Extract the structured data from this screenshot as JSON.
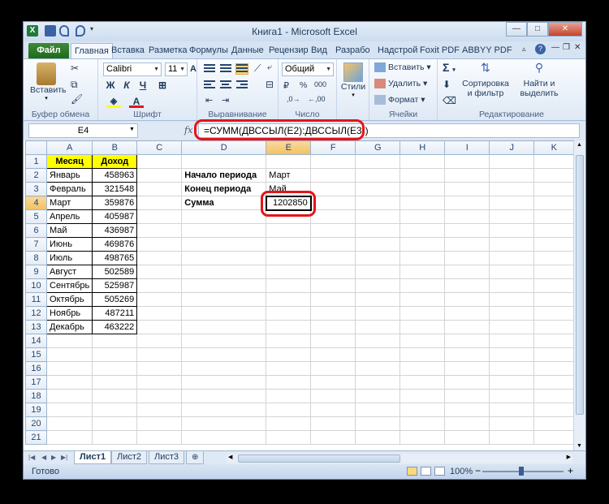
{
  "window": {
    "title": "Книга1  -  Microsoft Excel",
    "minimize": "—",
    "maximize": "□",
    "close": "✕"
  },
  "tabs": [
    {
      "label": "Файл"
    },
    {
      "label": "Главная"
    },
    {
      "label": "Вставка"
    },
    {
      "label": "Разметка"
    },
    {
      "label": "Формулы"
    },
    {
      "label": "Данные"
    },
    {
      "label": "Рецензир"
    },
    {
      "label": "Вид"
    },
    {
      "label": "Разрабо"
    },
    {
      "label": "Надстрой"
    },
    {
      "label": "Foxit PDF"
    },
    {
      "label": "ABBYY PDF"
    }
  ],
  "ribbon": {
    "clipboard": {
      "paste": "Вставить",
      "label": "Буфер обмена"
    },
    "font": {
      "name": "Calibri",
      "size": "11",
      "bold": "Ж",
      "italic": "К",
      "underline": "Ч",
      "label": "Шрифт",
      "grow": "A",
      "shrink": "A"
    },
    "alignment": {
      "label": "Выравнивание"
    },
    "number": {
      "format": "Общий",
      "label": "Число",
      "percent": "%",
      "thousands": "000"
    },
    "styles": {
      "label": "Стили"
    },
    "cells": {
      "insert": "Вставить",
      "delete": "Удалить",
      "format": "Формат",
      "label": "Ячейки"
    },
    "editing": {
      "sum": "Σ",
      "sort_line1": "Сортировка",
      "sort_line2": "и фильтр",
      "find_line1": "Найти и",
      "find_line2": "выделить",
      "label": "Редактирование"
    }
  },
  "formula_bar": {
    "name_box": "E4",
    "fx": "fx",
    "formula": "=СУММ(ДВССЫЛ(E2):ДВССЫЛ(E3))"
  },
  "columns": [
    "A",
    "B",
    "C",
    "D",
    "E",
    "F",
    "G",
    "H",
    "I",
    "J",
    "K"
  ],
  "rows": [
    {
      "n": "1",
      "a": "Месяц",
      "b": "Доход",
      "d": "",
      "e": ""
    },
    {
      "n": "2",
      "a": "Январь",
      "b": "458963",
      "d": "Начало периода",
      "e": "Март"
    },
    {
      "n": "3",
      "a": "Февраль",
      "b": "321548",
      "d": "Конец периода",
      "e": "Май"
    },
    {
      "n": "4",
      "a": "Март",
      "b": "359876",
      "d": "Сумма",
      "e": "1202850"
    },
    {
      "n": "5",
      "a": "Апрель",
      "b": "405987",
      "d": "",
      "e": ""
    },
    {
      "n": "6",
      "a": "Май",
      "b": "436987",
      "d": "",
      "e": ""
    },
    {
      "n": "7",
      "a": "Июнь",
      "b": "469876",
      "d": "",
      "e": ""
    },
    {
      "n": "8",
      "a": "Июль",
      "b": "498765",
      "d": "",
      "e": ""
    },
    {
      "n": "9",
      "a": "Август",
      "b": "502589",
      "d": "",
      "e": ""
    },
    {
      "n": "10",
      "a": "Сентябрь",
      "b": "525987",
      "d": "",
      "e": ""
    },
    {
      "n": "11",
      "a": "Октябрь",
      "b": "505269",
      "d": "",
      "e": ""
    },
    {
      "n": "12",
      "a": "Ноябрь",
      "b": "487211",
      "d": "",
      "e": ""
    },
    {
      "n": "13",
      "a": "Декабрь",
      "b": "463222",
      "d": "",
      "e": ""
    },
    {
      "n": "14",
      "a": "",
      "b": "",
      "d": "",
      "e": ""
    },
    {
      "n": "15",
      "a": "",
      "b": "",
      "d": "",
      "e": ""
    },
    {
      "n": "16",
      "a": "",
      "b": "",
      "d": "",
      "e": ""
    },
    {
      "n": "17",
      "a": "",
      "b": "",
      "d": "",
      "e": ""
    },
    {
      "n": "18",
      "a": "",
      "b": "",
      "d": "",
      "e": ""
    },
    {
      "n": "19",
      "a": "",
      "b": "",
      "d": "",
      "e": ""
    },
    {
      "n": "20",
      "a": "",
      "b": "",
      "d": "",
      "e": ""
    },
    {
      "n": "21",
      "a": "",
      "b": "",
      "d": "",
      "e": ""
    }
  ],
  "sheets": [
    {
      "label": "Лист1"
    },
    {
      "label": "Лист2"
    },
    {
      "label": "Лист3"
    }
  ],
  "status": {
    "ready": "Готово",
    "zoom": "100%",
    "zoom_out": "−",
    "zoom_in": "+"
  },
  "colors": {
    "header_fill": "#ffff00",
    "highlight": "#e4141a",
    "file_tab": "#2b7a26"
  }
}
